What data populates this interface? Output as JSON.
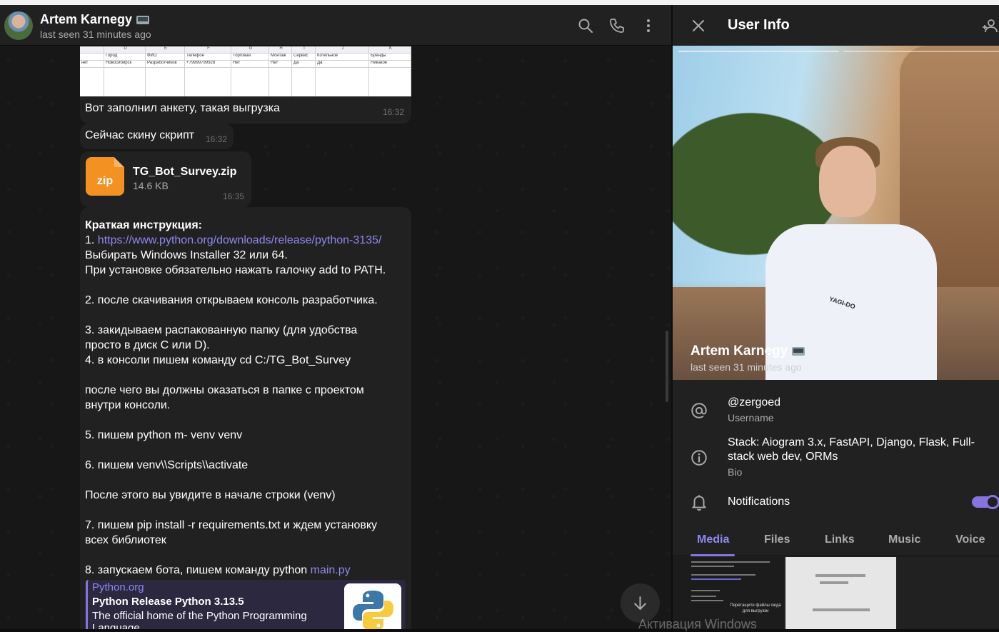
{
  "header": {
    "name": "Artem Karnegy",
    "status": "last seen 31 minutes ago"
  },
  "sheet": {
    "columns": [
      "D",
      "E",
      "F",
      "G",
      "H",
      "I",
      "J",
      "K"
    ],
    "headers": [
      "Город",
      "ФИО",
      "Телефон",
      "Торговая",
      "Монтаж",
      "Сервис",
      "Котельное",
      "Бренды"
    ],
    "values": [
      "Новосибирск",
      "Разработчиков",
      "+79999799928",
      "Нет",
      "Нет",
      "Да",
      "Да",
      "Никакое"
    ],
    "left_value": "нет"
  },
  "messages": {
    "m1_text": "Вот заполнил анкету, такая выгрузка",
    "m1_time": "16:32",
    "m2_text": "Сейчас скину скрипт",
    "m2_time": "16:32",
    "file_icon": "zip",
    "file_name": "TG_Bot_Survey.zip",
    "file_size": "14.6 KB",
    "file_time": "16:35",
    "instructions": {
      "l1": "Краткая инструкция:",
      "l2_prefix": "1. ",
      "l2_link": "https://www.python.org/downloads/release/python-3135/",
      "l3": "Выбирать Windows Installer 32 или 64.",
      "l4": "При установке обязательно нажать галочку add to PATH.",
      "l5": "2. после скачивания открываем консоль разработчика.",
      "l6": "3. закидываем  распакованную папку (для удобства",
      "l7": "просто в диск С или D).",
      "l8": "4. в консоли пишем команду cd C:/TG_Bot_Survey",
      "l9": "после чего вы должны оказаться в папке с проектом",
      "l10": "внутри консоли.",
      "l11": "5. пишем python m- venv venv",
      "l12": "6. пишем venv\\\\Scripts\\\\activate",
      "l13": "После этого вы увидите в начале строки (venv)",
      "l14": "7. пишем pip install -r requirements.txt и ждем установку",
      "l15": "всех библиотек",
      "l16_prefix": "8. запускаем бота, пишем команду python ",
      "l16_link": "main.py"
    },
    "preview": {
      "site": "Python.org",
      "title": "Python Release Python 3.13.5",
      "description": "The official home of the Python Programming Language"
    }
  },
  "info": {
    "title": "User Info",
    "name": "Artem Karnegy",
    "status": "last seen 31 minutes ago",
    "photo_shirt_text": "YAGI-DO",
    "username": "@zergoed",
    "username_label": "Username",
    "bio": "Stack: Aiogram 3.x, FastAPI, Django, Flask, Full-stack web dev, ORMs",
    "bio_label": "Bio",
    "notifications_label": "Notifications",
    "notifications_on": true,
    "tabs": [
      "Media",
      "Files",
      "Links",
      "Music",
      "Voice"
    ],
    "active_tab": "Media",
    "thumb_text": "Перетащите файлы сюда для выгрузки"
  },
  "watermark": "Активация Windows",
  "colors": {
    "accent": "#8774e1",
    "link": "#8e88f0",
    "bubble": "#212121",
    "panel": "#212121",
    "zip": "#f39222"
  },
  "icons": [
    "search-icon",
    "phone-icon",
    "more-icon",
    "close-icon",
    "add-contact-icon",
    "at-icon",
    "info-icon",
    "bell-icon",
    "arrow-down-icon",
    "laptop-icon",
    "python-logo"
  ]
}
